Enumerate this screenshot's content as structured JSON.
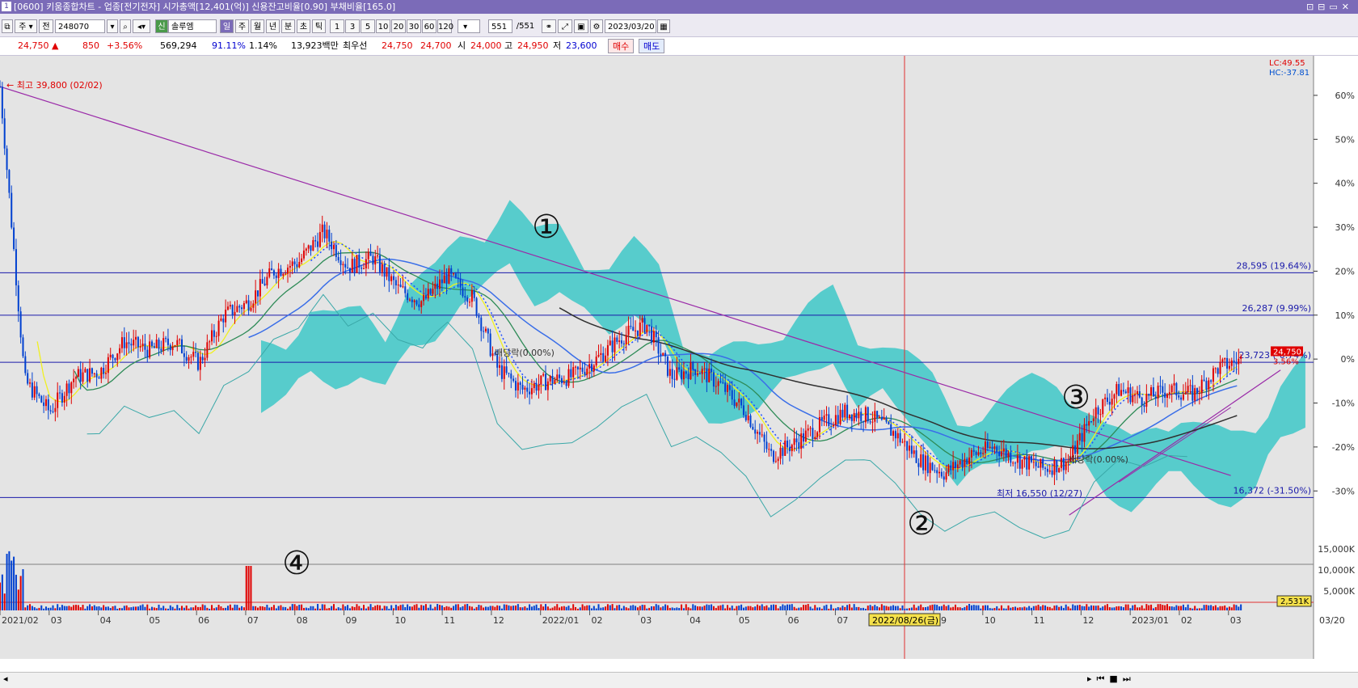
{
  "window": {
    "title": "[0600] 키움종합차트 - 업종[전기전자] 시가총액[12,401(억)] 신용잔고비율[0.90] 부채비율[165.0]",
    "controls": "⊡⊟▭✕"
  },
  "toolbar": {
    "market_btn": "주",
    "prev_btn": "전",
    "stock_code": "248070",
    "stock_tag": "신",
    "stock_name": "솔루엠",
    "period_tabs": [
      "일",
      "주",
      "월",
      "년",
      "분",
      "초",
      "틱"
    ],
    "interval_tabs": [
      "1",
      "3",
      "5",
      "10",
      "20",
      "30",
      "60",
      "120"
    ],
    "count_value": "551",
    "count_total": "/551",
    "date_value": "2023/03/20"
  },
  "quote": {
    "price": "24,750",
    "change": "850",
    "change_pct": "+3.56%",
    "volume": "569,294",
    "vol_ratio": "91.11%",
    "turnover": "1.14%",
    "amount": "13,923백만",
    "ask_label": "최우선",
    "ask": "24,750",
    "bid": "24,700",
    "open_label": "시",
    "open": "24,000",
    "high_label": "고",
    "high": "24,950",
    "low_label": "저",
    "low": "23,600",
    "buy_btn": "매수",
    "sell_btn": "매도"
  },
  "chart_data": {
    "type": "line",
    "symbol": "솔루엠",
    "x_axis_labels": [
      "2021/02",
      "03",
      "04",
      "05",
      "06",
      "07",
      "08",
      "09",
      "10",
      "11",
      "12",
      "2022/01",
      "02",
      "03",
      "04",
      "05",
      "06",
      "07",
      "08",
      "09",
      "10",
      "11",
      "12",
      "2023/01",
      "02",
      "03"
    ],
    "x_axis_right_label": "03/20",
    "crosshair_date": "2022/08/26(금)",
    "y_ticks_pct": [
      "60%",
      "50%",
      "40%",
      "30%",
      "20%",
      "10%",
      "0%",
      "-10%",
      "-20%",
      "-30%"
    ],
    "ylim_pct": [
      -34,
      69
    ],
    "lc_label": "LC:49.55",
    "hc_label": "HC:-37.81",
    "current_price": "24,750",
    "current_pct": "3.56%",
    "high_marker": "최고 39,800 (02/02)",
    "low_marker": "최저 16,550 (12/27)",
    "dividend_labels": [
      "배당락(0.00%)",
      "배당락(0.00%)"
    ],
    "hlines": [
      {
        "label": "28,595 (19.64%)",
        "pct": 19.64
      },
      {
        "label": "26,287 (9.99%)",
        "pct": 9.99
      },
      {
        "label": "23,723 (-0.74%)",
        "pct": -0.74
      },
      {
        "label": "16,372 (-31.50%)",
        "pct": -31.5
      }
    ],
    "annotations": [
      "①",
      "②",
      "③",
      "④"
    ],
    "price_series_pct": [
      [
        0,
        62
      ],
      [
        0.02,
        -5
      ],
      [
        0.04,
        -12
      ],
      [
        0.06,
        -4
      ],
      [
        0.08,
        -3
      ],
      [
        0.1,
        4
      ],
      [
        0.12,
        2
      ],
      [
        0.14,
        4
      ],
      [
        0.16,
        -1
      ],
      [
        0.18,
        10
      ],
      [
        0.2,
        13
      ],
      [
        0.22,
        20
      ],
      [
        0.24,
        22
      ],
      [
        0.26,
        29
      ],
      [
        0.28,
        21
      ],
      [
        0.3,
        23
      ],
      [
        0.32,
        16
      ],
      [
        0.34,
        13
      ],
      [
        0.36,
        19
      ],
      [
        0.38,
        14
      ],
      [
        0.4,
        -2
      ],
      [
        0.42,
        -7
      ],
      [
        0.44,
        -5
      ],
      [
        0.46,
        -4
      ],
      [
        0.48,
        0
      ],
      [
        0.5,
        5
      ],
      [
        0.52,
        8
      ],
      [
        0.54,
        -4
      ],
      [
        0.56,
        -2
      ],
      [
        0.58,
        -6
      ],
      [
        0.6,
        -12
      ],
      [
        0.62,
        -22
      ],
      [
        0.64,
        -19
      ],
      [
        0.66,
        -15
      ],
      [
        0.68,
        -12
      ],
      [
        0.7,
        -13
      ],
      [
        0.72,
        -17
      ],
      [
        0.74,
        -23
      ],
      [
        0.76,
        -26
      ],
      [
        0.78,
        -22
      ],
      [
        0.8,
        -20
      ],
      [
        0.82,
        -23
      ],
      [
        0.84,
        -25
      ],
      [
        0.86,
        -23
      ],
      [
        0.88,
        -12
      ],
      [
        0.9,
        -7
      ],
      [
        0.92,
        -9
      ],
      [
        0.94,
        -7
      ],
      [
        0.96,
        -8
      ],
      [
        0.98,
        -2
      ],
      [
        1.0,
        0
      ]
    ],
    "volume_axis_labels": [
      "15,000K",
      "10,000K",
      "5,000K"
    ],
    "volume_current": "2,531K"
  }
}
